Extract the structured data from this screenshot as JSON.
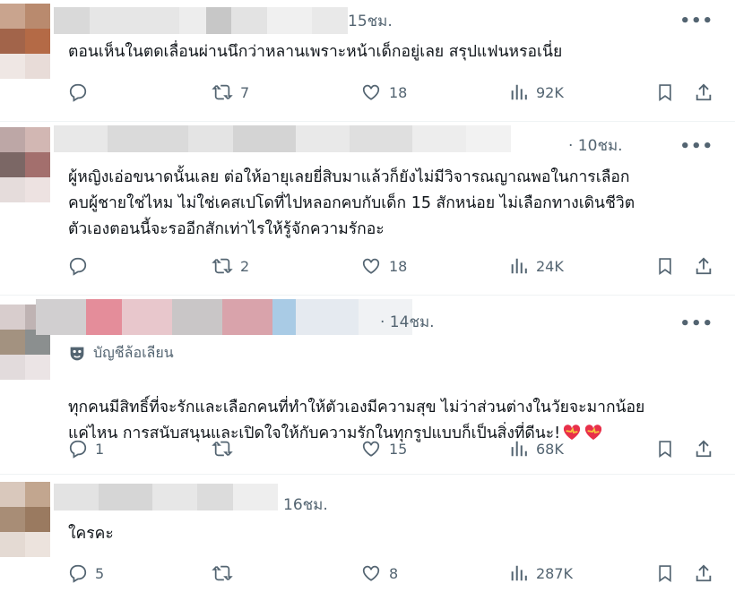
{
  "posts": [
    {
      "time": "15ชม.",
      "text": "ตอนเห็นในตดเลื่อนผ่านนึกว่าหลานเพราะหน้าเด็กอยู่เลย สรุปแฟนหรอเนี่ย",
      "parody_label": "",
      "replies": "",
      "reposts": "7",
      "likes": "18",
      "views": "92K"
    },
    {
      "time": "· 10ชม.",
      "text": "ผู้หญิงเอ่อขนาดนั้นเลย ต่อให้อายุเลยยี่สิบมาแล้วก็ยังไม่มีวิจารณญาณพอในการเลือก\nคบผู้ชายใช่ไหม ไม่ใช่เคสเปโดที่ไปหลอกคบกับเด็ก 15 สักหน่อย ไม่เลือกทางเดินชีวิต\nตัวเองตอนนี้จะรออีกสักเท่าไรให้รู้จักความรักอะ",
      "parody_label": "",
      "replies": "",
      "reposts": "2",
      "likes": "18",
      "views": "24K"
    },
    {
      "time": "· 14ชม.",
      "text": "ทุกคนมีสิทธิ์ที่จะรักและเลือกคนที่ทำให้ตัวเองมีความสุข ไม่ว่าส่วนต่างในวัยจะมากน้อย\nแค่ไหน การสนับสนุนและเปิดใจให้กับความรักในทุกรูปแบบก็เป็นสิ่งที่ดีนะ!",
      "parody_label": "บัญชีล้อเลียน",
      "replies": "1",
      "reposts": "",
      "likes": "15",
      "views": "68K"
    },
    {
      "time": "16ชม.",
      "text": "ใครคะ",
      "parody_label": "",
      "replies": "5",
      "reposts": "",
      "likes": "8",
      "views": "287K"
    }
  ],
  "icons": {
    "reply": "reply-icon",
    "repost": "repost-icon",
    "like": "heart-icon",
    "views": "views-icon",
    "bookmark": "bookmark-icon",
    "share": "share-icon",
    "more": "more-icon"
  },
  "colors": {
    "text": "#0f1419",
    "muted": "#536471"
  }
}
